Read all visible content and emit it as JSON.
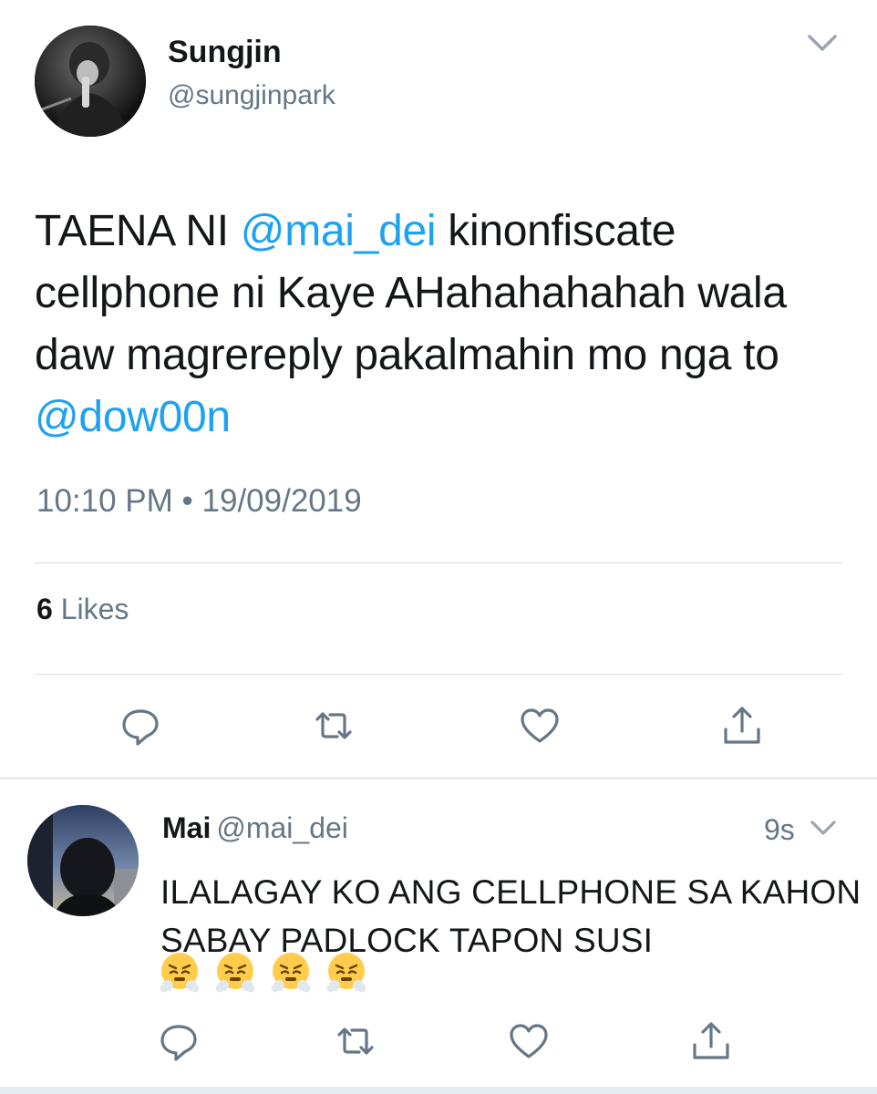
{
  "main_tweet": {
    "display_name": "Sungjin",
    "handle": "@sungjinpark",
    "text_parts": {
      "p1": "TAENA NI ",
      "mention1": "@mai_dei",
      "p2": " kinonfiscate cellphone ni Kaye AHahahahahah wala daw magrereply pakalmahin mo nga to ",
      "mention2": "@dow00n"
    },
    "timestamp": "10:10 PM • 19/09/2019",
    "likes_count": "6",
    "likes_label": "Likes"
  },
  "reply": {
    "display_name": "Mai",
    "handle": "@mai_dei",
    "time": "9s",
    "text": "ILALAGAY KO ANG CELLPHONE SA KAHON SABAY PADLOCK TAPON SUSI",
    "emojis": [
      "face-with-steam-from-nose",
      "face-with-steam-from-nose",
      "face-with-steam-from-nose",
      "face-with-steam-from-nose"
    ]
  },
  "icons": {
    "reply": "reply-icon",
    "retweet": "retweet-icon",
    "like": "heart-icon",
    "share": "share-icon",
    "more": "chevron-down-icon"
  },
  "colors": {
    "mention": "#1da1f2",
    "secondary_text": "#657786",
    "primary_text": "#14171a",
    "divider": "#d6dbe0"
  }
}
